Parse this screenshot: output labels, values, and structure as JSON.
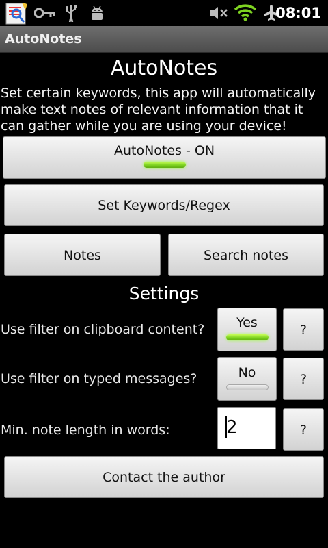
{
  "status_bar": {
    "time": "08:01",
    "icons": [
      "app-notification-icon",
      "key-icon",
      "usb-icon",
      "android-debug-icon",
      "mute-icon",
      "wifi-icon",
      "airplane-icon"
    ]
  },
  "title_bar": {
    "title": "AutoNotes"
  },
  "main": {
    "heading": "AutoNotes",
    "description": "Set certain keywords, this app will automatically make text notes of relevant information that it can gather while you are using your device!",
    "toggle_button": {
      "label": "AutoNotes - ON",
      "state": "on"
    },
    "keywords_button": "Set Keywords/Regex",
    "notes_button": "Notes",
    "search_button": "Search notes",
    "contact_button": "Contact the author"
  },
  "settings": {
    "heading": "Settings",
    "clipboard_filter": {
      "label": "Use filter on clipboard content?",
      "value": "Yes",
      "state": "on",
      "help": "?"
    },
    "typed_filter": {
      "label": "Use filter on typed messages?",
      "value": "No",
      "state": "off",
      "help": "?"
    },
    "min_length": {
      "label": "Min. note length in words:",
      "value": "2",
      "help": "?"
    }
  },
  "colors": {
    "background": "#000000",
    "title_bar": "#5a5a5a",
    "indicator_on": "#7ed321",
    "button": "#e6e6e6"
  }
}
